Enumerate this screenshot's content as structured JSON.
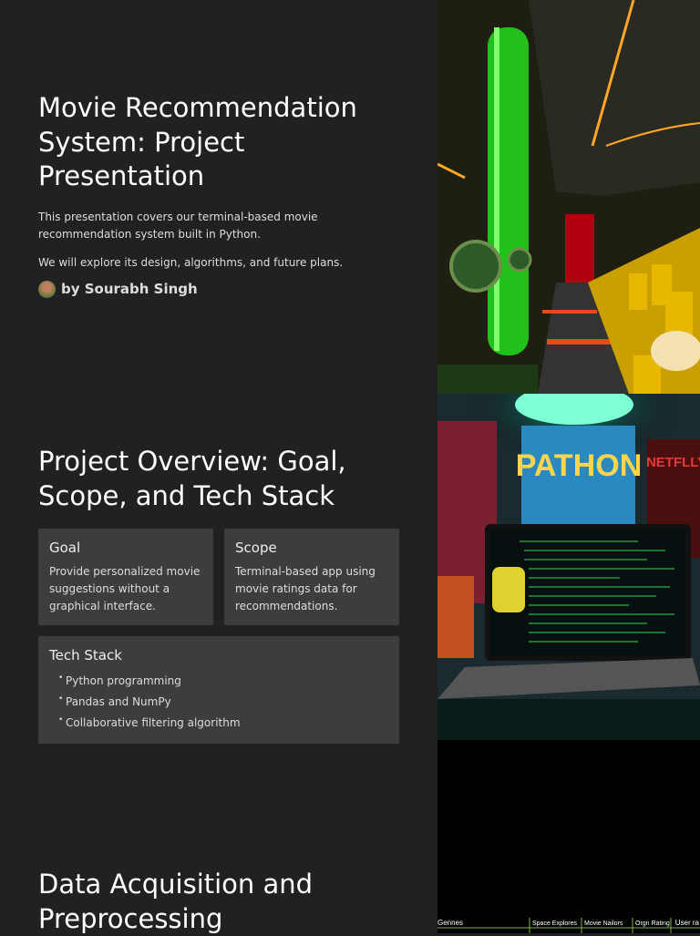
{
  "slide1": {
    "title": "Movie Recommendation System: Project Presentation",
    "para1": "This presentation covers our terminal-based movie recommendation system built in Python.",
    "para2": "We will explore its design, algorithms, and future plans.",
    "author": "by Sourabh Singh"
  },
  "slide2": {
    "title": "Project Overview: Goal, Scope, and Tech Stack",
    "cards": [
      {
        "title": "Goal",
        "text": "Provide personalized movie suggestions without a graphical interface."
      },
      {
        "title": "Scope",
        "text": "Terminal-based app using movie ratings data for recommendations."
      }
    ],
    "tech": {
      "title": "Tech Stack",
      "items": [
        "Python programming",
        "Pandas and NumPy",
        "Collaborative filtering algorithm"
      ]
    }
  },
  "slide3": {
    "title": "Data Acquisition and Preprocessing"
  },
  "image2": {
    "poster_text": "PATHON",
    "poster_brand": "NETFLLY",
    "table_headers": [
      "Gennes",
      "Space Explores",
      "Movie Nailors",
      "Orgn Rating",
      "User ra"
    ]
  }
}
